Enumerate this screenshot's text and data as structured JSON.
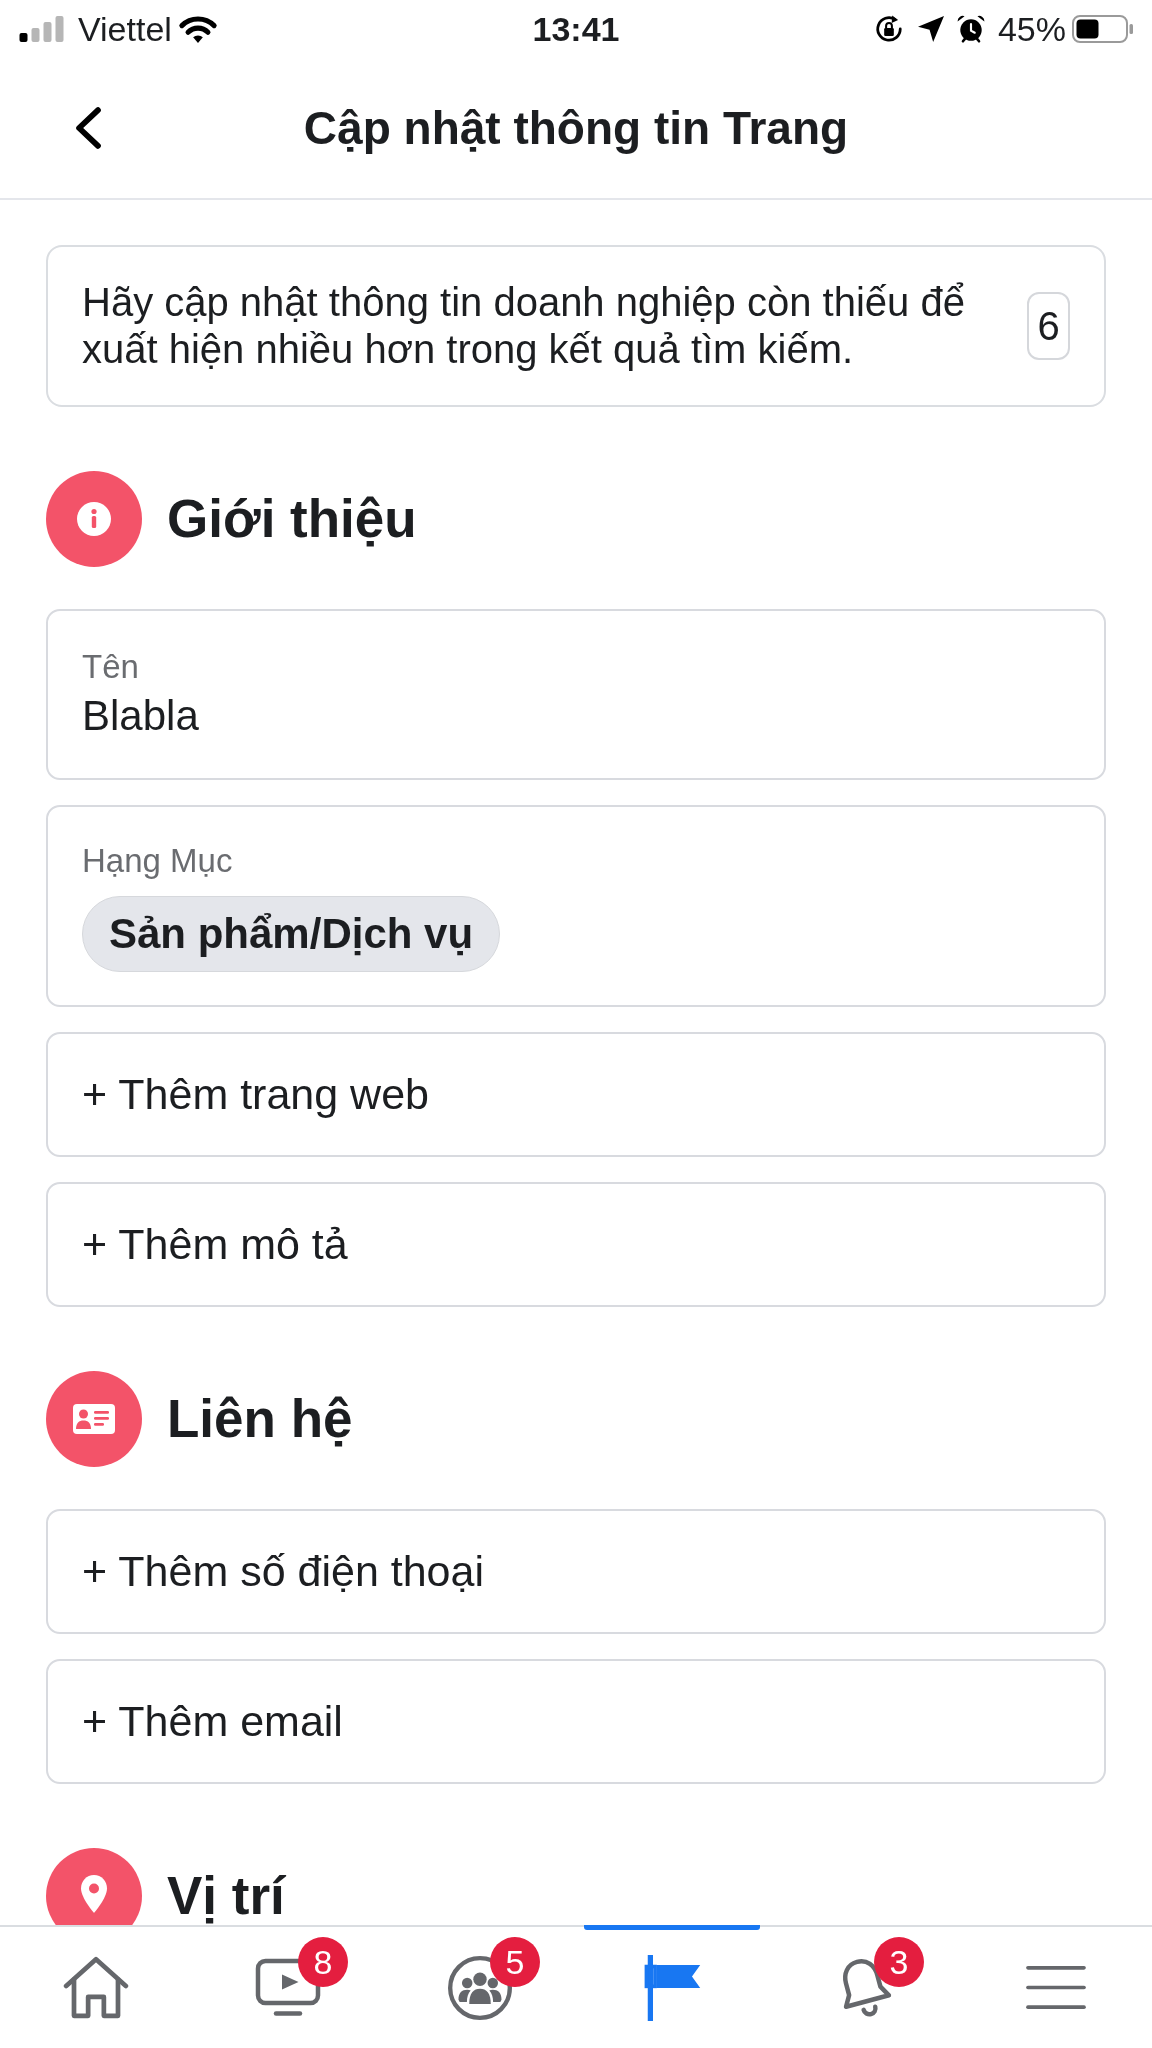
{
  "status_bar": {
    "carrier": "Viettel",
    "time": "13:41",
    "battery": "45%"
  },
  "header": {
    "title": "Cập nhật thông tin Trang"
  },
  "notice": {
    "text": "Hãy cập nhật thông tin doanh nghiệp còn thiếu để xuất hiện nhiều hơn trong kết quả tìm kiếm.",
    "count": "6"
  },
  "sections": [
    {
      "kind": "info",
      "title": "Giới thiệu",
      "items": [
        {
          "kind": "field",
          "label": "Tên",
          "value": "Blabla"
        },
        {
          "kind": "category",
          "label": "Hạng Mục",
          "chips": [
            "Sản phẩm/Dịch vụ"
          ]
        },
        {
          "kind": "add",
          "text": "+ Thêm trang web"
        },
        {
          "kind": "add",
          "text": "+ Thêm mô tả"
        }
      ]
    },
    {
      "kind": "contact",
      "title": "Liên hệ",
      "items": [
        {
          "kind": "add",
          "text": "+ Thêm số điện thoại"
        },
        {
          "kind": "add",
          "text": "+ Thêm email"
        }
      ]
    },
    {
      "kind": "location",
      "title": "Vị trí"
    }
  ],
  "tab_bar": {
    "items": [
      {
        "kind": "home",
        "selected": false
      },
      {
        "kind": "watch",
        "badge": "8",
        "selected": false
      },
      {
        "kind": "groups",
        "badge": "5",
        "selected": false
      },
      {
        "kind": "pages",
        "selected": true
      },
      {
        "kind": "notifications",
        "badge": "3",
        "selected": false
      },
      {
        "kind": "menu",
        "selected": false
      }
    ]
  }
}
